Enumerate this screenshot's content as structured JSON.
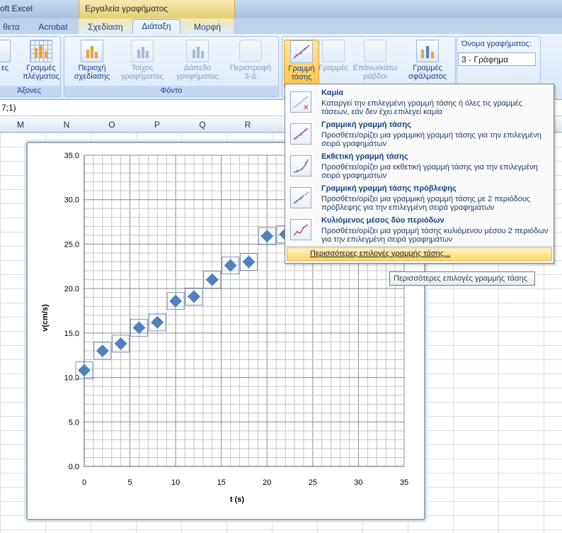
{
  "titlebar": {
    "app_title": "oft Excel",
    "context_title": "Εργαλεία γραφήματος"
  },
  "tabs": [
    {
      "label": "θετα"
    },
    {
      "label": "Acrobat"
    },
    {
      "label": "Σχεδίαση"
    },
    {
      "label": "Διάταξη"
    },
    {
      "label": "Μορφή"
    }
  ],
  "ribbon": {
    "group_axes": {
      "label": "Άξονες",
      "btn1": "ες",
      "btn2_l1": "Γραμμές",
      "btn2_l2": "πλέγματος"
    },
    "group_background": {
      "label": "Φόντο",
      "b1_l1": "Περιοχή",
      "b1_l2": "σχεδίασης",
      "b2_l1": "Τοίχος",
      "b2_l2": "γραφήματος",
      "b3_l1": "Δάπεδο",
      "b3_l2": "γραφήματος",
      "b4_l1": "Περιστροφή",
      "b4_l2": "3-Δ"
    },
    "group_analysis": {
      "b1_l1": "Γραμμή",
      "b1_l2": "τάσης",
      "b2_l1": "Γραμμές",
      "b3_l1": "Επάνω/κάτω",
      "b3_l2": "ράβδοι",
      "b4_l1": "Γραμμές",
      "b4_l2": "σφάλματος"
    },
    "chart_name": {
      "label": "Όνομα γραφήματος:",
      "value": "3 - Γράφημα"
    }
  },
  "formula_bar": {
    "text": "7;1)"
  },
  "columns": [
    "M",
    "N",
    "O",
    "P",
    "Q",
    "R"
  ],
  "menu": {
    "items": [
      {
        "title": "Καμία",
        "desc": "Καταργεί την επιλεγμένη γραμμή τάσης ή όλες τις γραμμές τάσεων, εάν δεν έχει επιλεγεί καμία"
      },
      {
        "title": "Γραμμική γραμμή τάσης",
        "desc": "Προσθέτει/ορίζει μια γραμμική γραμμή τάσης για την επιλεγμένη σειρά γραφημάτων"
      },
      {
        "title": "Εκθετική γραμμή τάσης",
        "desc": "Προσθέτει/ορίζει μια εκθετική γραμμή τάσης για την επιλεγμένη σειρά γραφημάτων"
      },
      {
        "title": "Γραμμική γραμμή τάσης πρόβλεψης",
        "desc": "Προσθέτει/ορίζει μια γραμμική γραμμή τάσης με 2 περιόδους πρόβλεψης για την επιλεγμένη σειρά γραφημάτων"
      },
      {
        "title": "Κυλιόμενος μέσος δύο περιόδων",
        "desc": "Προσθέτει/ορίζει μια γραμμή τάσης κυλιόμενου μέσου 2 περιόδων για την επιλεγμένη σειρά γραφημάτων"
      }
    ],
    "more": "Περισσότερες επιλογές γραμμής τάσης..."
  },
  "tooltip": "Περισσότερες επιλογές γραμμής τάσης",
  "colors": {
    "marker": "#4f81bd",
    "accent": "#15428b"
  },
  "chart_data": {
    "type": "scatter",
    "xlabel": "t (s)",
    "ylabel": "v(cm/s)",
    "xlim": [
      0,
      35
    ],
    "ylim": [
      0,
      35
    ],
    "xticks": [
      0,
      5,
      10,
      15,
      20,
      25,
      30,
      35
    ],
    "yticks": [
      "0.0",
      "5.0",
      "10.0",
      "15.0",
      "20.0",
      "25.0",
      "30.0",
      "35.0"
    ],
    "grid": true,
    "series": [
      {
        "x": [
          0,
          2,
          4,
          6,
          8,
          10,
          12,
          14,
          16,
          18,
          20,
          22
        ],
        "y": [
          10.8,
          13.0,
          13.8,
          15.6,
          16.2,
          18.6,
          19.1,
          21.0,
          22.6,
          23.0,
          25.9,
          26.1
        ]
      }
    ]
  }
}
